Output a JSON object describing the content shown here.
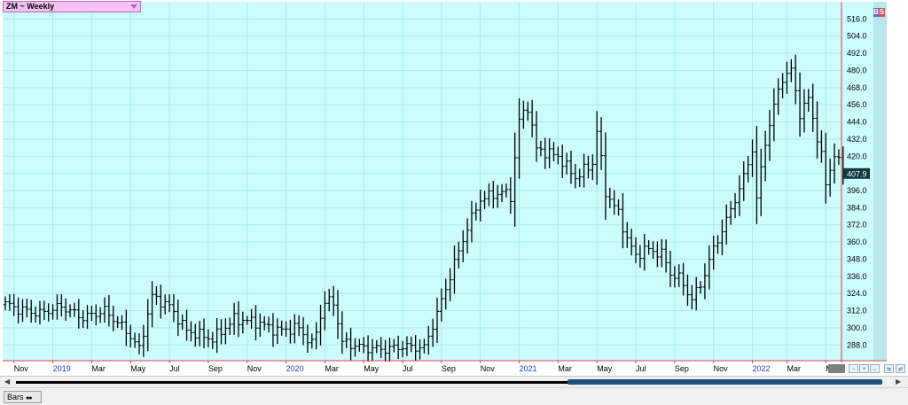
{
  "window": {
    "ticker_title": "ZM ~ Weekly"
  },
  "status": {
    "tab_label": "Bars"
  },
  "badges": {
    "buy": "B",
    "sell": "S"
  },
  "colors": {
    "plot_bg": "#ccfcfc",
    "grid": "#a8ecec",
    "bar": "#000000",
    "x_labels": "#000000",
    "year_labels": "#1f3fbf",
    "axis_line": "#e04040",
    "last_price_bg": "#0f3a3a"
  },
  "chart_data": {
    "type": "ohlc",
    "title": "ZM ~ Weekly",
    "series_name": "ZM",
    "y_ticks": [
      288.0,
      300.0,
      312.0,
      324.0,
      336.0,
      348.0,
      360.0,
      372.0,
      384.0,
      396.0,
      408.0,
      420.0,
      432.0,
      444.0,
      456.0,
      468.0,
      480.0,
      492.0,
      504.0,
      516.0
    ],
    "y_tick_labels": [
      "288.0",
      "300.0",
      "312.0",
      "324.0",
      "336.0",
      "348.0",
      "360.0",
      "372.0",
      "384.0",
      "396.0",
      "408.0",
      "420.0",
      "432.0",
      "444.0",
      "456.0",
      "468.0",
      "480.0",
      "492.0",
      "504.0",
      "516.0"
    ],
    "ylim": [
      277,
      528
    ],
    "grid": true,
    "last_price": 407.9,
    "last_price_label": "407.9",
    "x_ticks": [
      {
        "label": "Nov",
        "week": 2,
        "year": false
      },
      {
        "label": "2019",
        "week": 11,
        "year": true
      },
      {
        "label": "Mar",
        "week": 20,
        "year": false
      },
      {
        "label": "May",
        "week": 29,
        "year": false
      },
      {
        "label": "Jul",
        "week": 38,
        "year": false
      },
      {
        "label": "Sep",
        "week": 47,
        "year": false
      },
      {
        "label": "Nov",
        "week": 56,
        "year": false
      },
      {
        "label": "2020",
        "week": 65,
        "year": true
      },
      {
        "label": "Mar",
        "week": 74,
        "year": false
      },
      {
        "label": "May",
        "week": 83,
        "year": false
      },
      {
        "label": "Jul",
        "week": 92,
        "year": false
      },
      {
        "label": "Sep",
        "week": 101,
        "year": false
      },
      {
        "label": "Nov",
        "week": 110,
        "year": false
      },
      {
        "label": "2021",
        "week": 119,
        "year": true
      },
      {
        "label": "Mar",
        "week": 128,
        "year": false
      },
      {
        "label": "May",
        "week": 137,
        "year": false
      },
      {
        "label": "Jul",
        "week": 146,
        "year": false
      },
      {
        "label": "Sep",
        "week": 155,
        "year": false
      },
      {
        "label": "Nov",
        "week": 164,
        "year": false
      },
      {
        "label": "2022",
        "week": 173,
        "year": true
      },
      {
        "label": "Mar",
        "week": 181,
        "year": false
      },
      {
        "label": "May",
        "week": 190,
        "year": false
      }
    ],
    "anchors": [
      [
        0,
        317
      ],
      [
        3,
        313
      ],
      [
        8,
        310
      ],
      [
        13,
        315
      ],
      [
        18,
        307
      ],
      [
        23,
        312
      ],
      [
        28,
        298
      ],
      [
        31,
        285
      ],
      [
        34,
        322
      ],
      [
        38,
        315
      ],
      [
        42,
        298
      ],
      [
        48,
        292
      ],
      [
        53,
        306
      ],
      [
        58,
        304
      ],
      [
        63,
        298
      ],
      [
        68,
        300
      ],
      [
        71,
        288
      ],
      [
        74,
        318
      ],
      [
        76,
        318
      ],
      [
        78,
        290
      ],
      [
        83,
        286
      ],
      [
        88,
        285
      ],
      [
        92,
        287
      ],
      [
        97,
        286
      ],
      [
        100,
        310
      ],
      [
        104,
        345
      ],
      [
        107,
        370
      ],
      [
        110,
        390
      ],
      [
        115,
        395
      ],
      [
        117,
        392
      ],
      [
        119,
        445
      ],
      [
        121,
        455
      ],
      [
        123,
        425
      ],
      [
        128,
        420
      ],
      [
        132,
        405
      ],
      [
        136,
        415
      ],
      [
        137,
        438
      ],
      [
        139,
        395
      ],
      [
        142,
        380
      ],
      [
        144,
        362
      ],
      [
        146,
        350
      ],
      [
        148,
        355
      ],
      [
        152,
        352
      ],
      [
        154,
        338
      ],
      [
        156,
        335
      ],
      [
        159,
        320
      ],
      [
        161,
        330
      ],
      [
        164,
        355
      ],
      [
        167,
        375
      ],
      [
        171,
        405
      ],
      [
        173,
        425
      ],
      [
        174,
        390
      ],
      [
        176,
        430
      ],
      [
        178,
        455
      ],
      [
        180,
        475
      ],
      [
        182,
        480
      ],
      [
        184,
        450
      ],
      [
        186,
        460
      ],
      [
        189,
        420
      ],
      [
        190,
        400
      ],
      [
        192,
        422
      ],
      [
        194,
        408
      ]
    ]
  }
}
